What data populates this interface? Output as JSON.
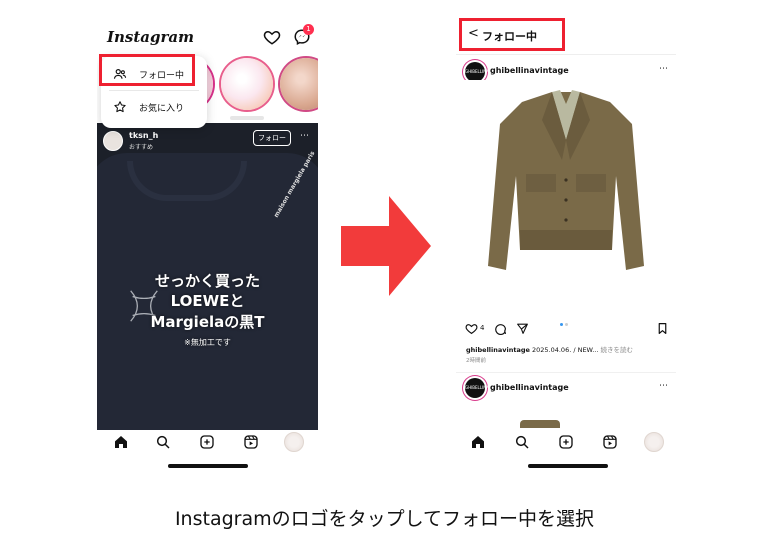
{
  "left_screen": {
    "header": {
      "logo": "Instagram",
      "notification_count": "1"
    },
    "dropdown": {
      "items": [
        {
          "label": "フォロー中",
          "icon": "people-icon"
        },
        {
          "label": "お気に入り",
          "icon": "star-icon"
        }
      ]
    },
    "post": {
      "username": "tksn_h",
      "subtitle": "おすすめ",
      "follow_label": "フォロー",
      "shirt_print": "maison margiela paris",
      "overlay_line1": "せっかく買った",
      "overlay_line2": "LOEWEと",
      "overlay_line3": "Margielaの黒T",
      "overlay_note": "※無加工です"
    },
    "tabbar": [
      "home-icon",
      "search-icon",
      "create-icon",
      "reels-icon",
      "profile-avatar"
    ]
  },
  "right_screen": {
    "header": {
      "back_glyph": "<",
      "title": "フォロー中"
    },
    "post1": {
      "username": "ghibellinavintage",
      "avatar_text": "GHIBELLINA",
      "like_count": "4",
      "caption_user": "ghibellinavintage",
      "caption_text": " 2025.04.06. / NEW... ",
      "caption_more": "続きを読む",
      "time": "2時間前"
    },
    "post2": {
      "username": "ghibellinavintage",
      "avatar_text": "GHIBELLINA"
    },
    "tabbar": [
      "home-icon",
      "search-icon",
      "create-icon",
      "reels-icon",
      "profile-avatar"
    ]
  },
  "colors": {
    "highlight_red": "#ee2030",
    "arrow_red": "#f23b3b",
    "story_ring": "#d8318a",
    "jacket": "#7a6a48"
  },
  "caption": "Instagramのロゴをタップしてフォロー中を選択"
}
